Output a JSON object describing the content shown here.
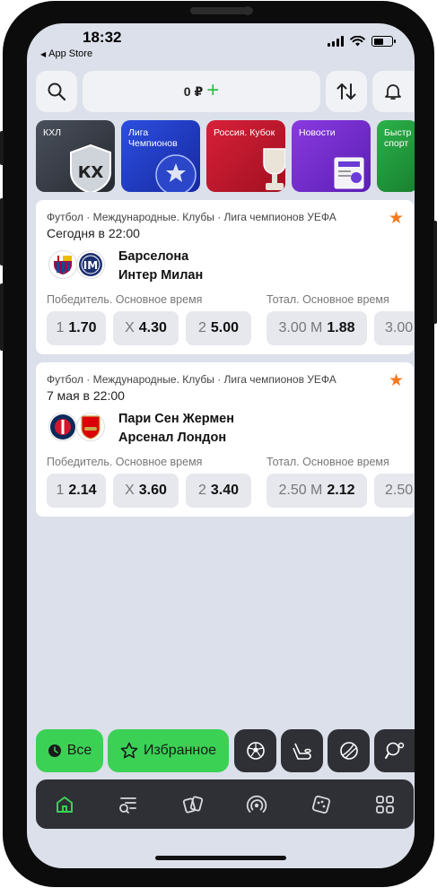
{
  "status_bar": {
    "time": "18:32",
    "back_app": "App Store",
    "back_icon": "triangle-left-icon"
  },
  "top_bar": {
    "balance": "0 ₽",
    "add_symbol": "+",
    "icons": [
      "search-icon",
      "sort-arrows-icon",
      "bell-icon"
    ]
  },
  "categories": [
    {
      "label": "КХЛ",
      "color": "#3a3f4a"
    },
    {
      "label": "Лига\nЧемпионов",
      "color": "#1f3fc8"
    },
    {
      "label": "Россия. Кубок",
      "color": "#c4162c"
    },
    {
      "label": "Новости",
      "color": "#7b2ed0"
    },
    {
      "label": "Быстр\nспорт",
      "color": "#229a3a"
    }
  ],
  "matches": [
    {
      "league": "Футбол · Международные. Клубы · Лига чемпионов УЕФА",
      "date": "Сегодня в 22:00",
      "team1": "Барселона",
      "team2": "Интер Милан",
      "market1_label": "Победитель. Основное время",
      "market2_label": "Тотал. Основное время",
      "odds": [
        {
          "label": "1",
          "value": "1.70"
        },
        {
          "label": "X",
          "value": "4.30"
        },
        {
          "label": "2",
          "value": "5.00"
        },
        {
          "label": "3.00 М",
          "value": "1.88"
        },
        {
          "label": "3.00",
          "value": ""
        }
      ]
    },
    {
      "league": "Футбол · Международные. Клубы · Лига чемпионов УЕФА",
      "date": "7 мая в 22:00",
      "team1": "Пари Сен Жермен",
      "team2": "Арсенал Лондон",
      "market1_label": "Победитель. Основное время",
      "market2_label": "Тотал. Основное время",
      "odds": [
        {
          "label": "1",
          "value": "2.14"
        },
        {
          "label": "X",
          "value": "3.60"
        },
        {
          "label": "2",
          "value": "3.40"
        },
        {
          "label": "2.50 М",
          "value": "2.12"
        },
        {
          "label": "2.50",
          "value": ""
        }
      ]
    }
  ],
  "filters": {
    "all": "Все",
    "favorites": "Избранное",
    "sport_icons": [
      "football-icon",
      "hockey-icon",
      "tennis-icon",
      "table-tennis-icon"
    ]
  },
  "bottom_nav": [
    "home-icon",
    "search-list-icon",
    "tickets-icon",
    "live-icon",
    "dice-icon",
    "grid-icon"
  ],
  "colors": {
    "accent_green": "#3bd155",
    "favorite_star": "#f57a1f",
    "dark_panel": "#2e3036",
    "screen_bg": "#dce0ea"
  }
}
